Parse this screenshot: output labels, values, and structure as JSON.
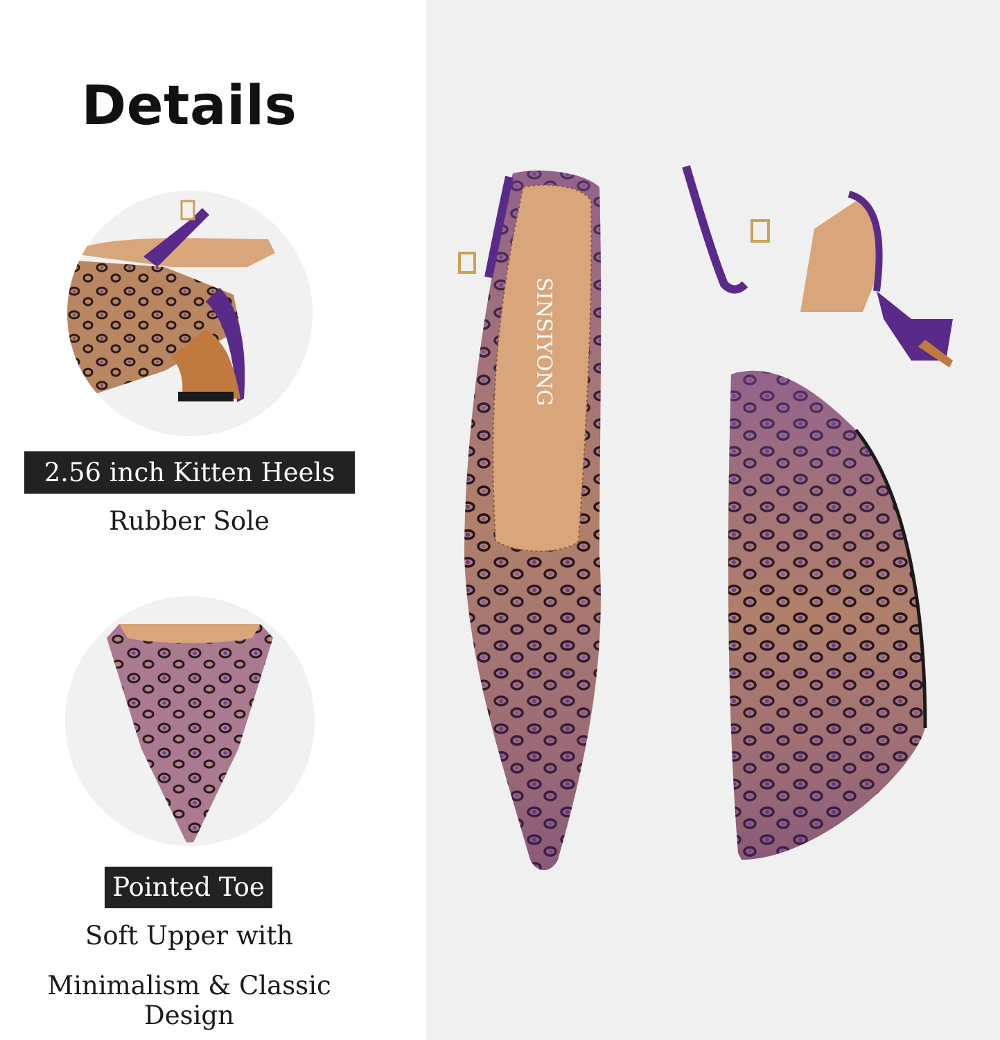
{
  "heading": "Details",
  "features": [
    {
      "label": "2.56 inch Kitten Heels",
      "description": "Rubber Sole"
    },
    {
      "label": "Pointed Toe",
      "description_line1": "Soft Upper with",
      "description_line2": "Minimalism & Classic Design"
    }
  ],
  "brand_on_insole": "SINSIYONG",
  "colors": {
    "purple": "#5a2a8a",
    "leopard_tan": "#b88660",
    "insole": "#d9a57b",
    "label_bg": "#222222"
  }
}
